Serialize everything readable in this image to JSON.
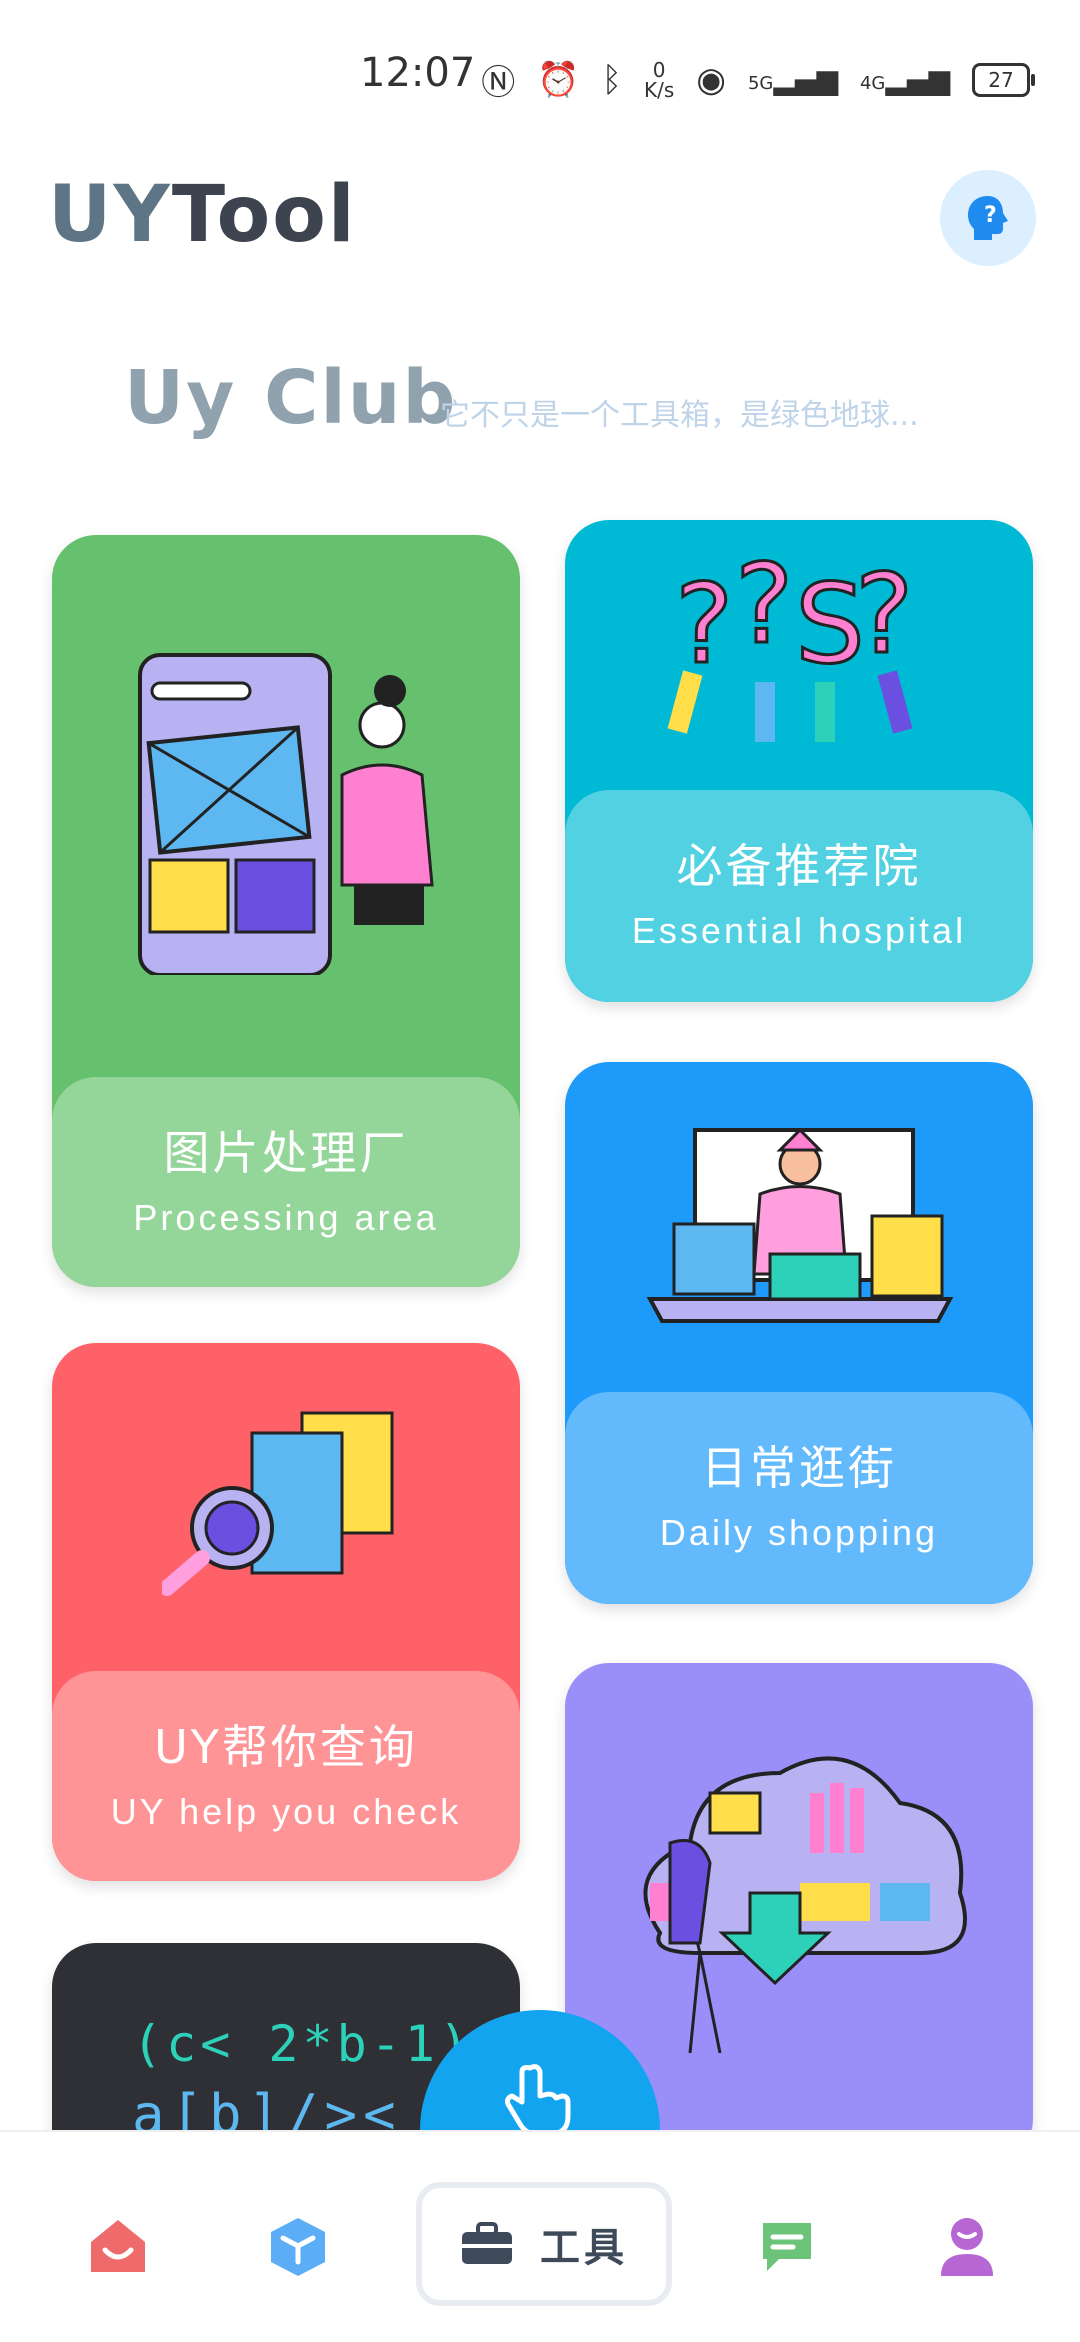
{
  "status_bar": {
    "time": "12:07",
    "net_speed_top": "0",
    "net_speed_unit": "K/s",
    "signal_1": "5G",
    "signal_2": "4G",
    "battery": "27"
  },
  "header": {
    "logo_part1": "UY",
    "logo_part2": "Tool",
    "help_icon": "help-head-icon"
  },
  "club": {
    "title": "Uy Club",
    "subtitle": "它不只是一个工具箱，是绿色地球..."
  },
  "cards": [
    {
      "zh": "图片处理厂",
      "en": "Processing area",
      "color": "#66c16e",
      "panel": "#94d699"
    },
    {
      "zh": "必备推荐院",
      "en": "Essential hospital",
      "color": "#00b9d4",
      "panel": "#52d1e3"
    },
    {
      "zh": "日常逛街",
      "en": "Daily shopping",
      "color": "#1e9bfa",
      "panel": "#62b9fb"
    },
    {
      "zh": "UY帮你查询",
      "en": "UY help you check",
      "color": "#ff6168",
      "panel": "#ff9497"
    },
    {
      "zh": "",
      "en": "",
      "color": "#9a8ef8",
      "panel": "#9a8ef8"
    },
    {
      "code_line1": "(c< 2*b-1)",
      "code_line2": "a[b]/><",
      "color": "#2f3035"
    }
  ],
  "nav": {
    "tools_label": "工具",
    "items": [
      "home-icon",
      "cube-icon",
      "toolbox-icon",
      "message-icon",
      "profile-icon"
    ]
  }
}
